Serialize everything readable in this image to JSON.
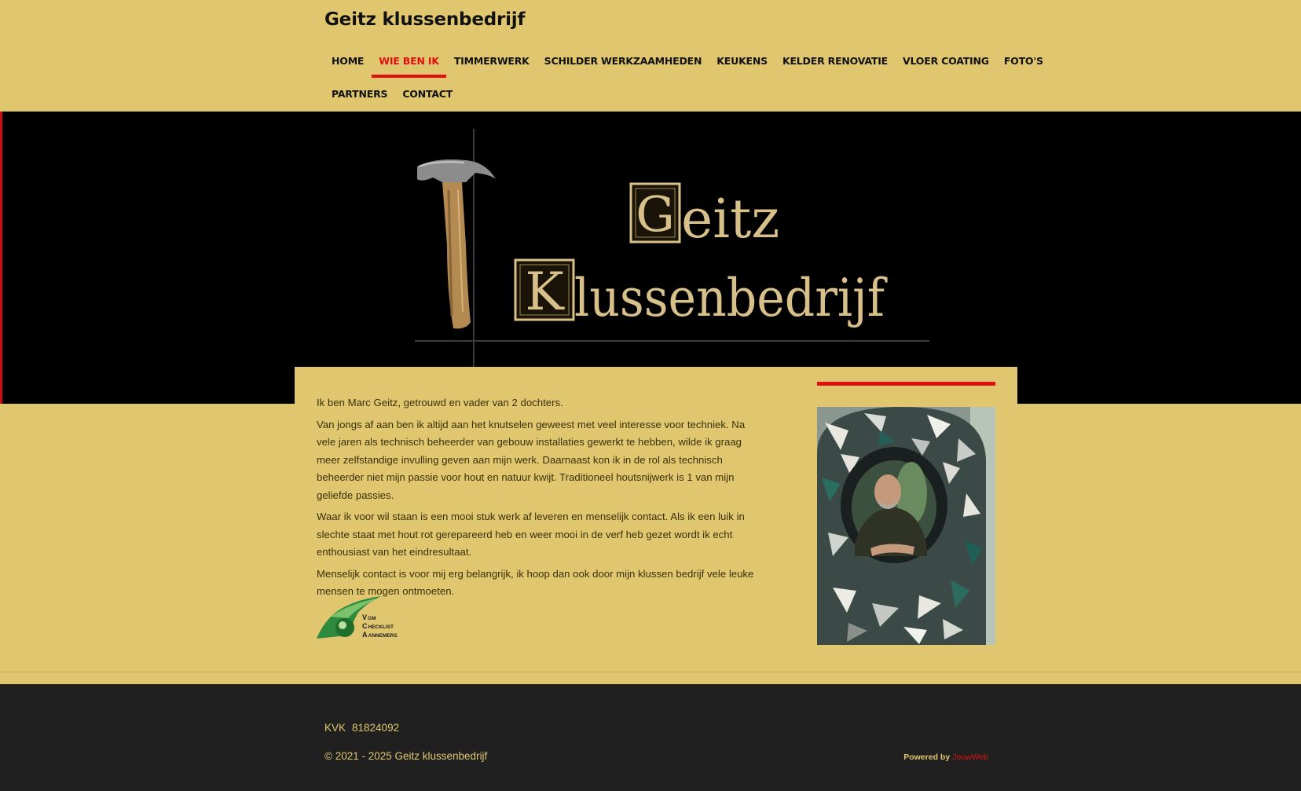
{
  "header": {
    "site_title": "Geitz klussenbedrijf",
    "nav_row1": [
      {
        "label": "HOME",
        "active": false
      },
      {
        "label": "WIE BEN IK",
        "active": true
      },
      {
        "label": "TIMMERWERK",
        "active": false
      },
      {
        "label": "SCHILDER WERKZAAMHEDEN",
        "active": false
      },
      {
        "label": "KEUKENS",
        "active": false
      },
      {
        "label": "KELDER RENOVATIE",
        "active": false
      },
      {
        "label": "VLOER COATING",
        "active": false
      },
      {
        "label": "FOTO'S",
        "active": false
      }
    ],
    "nav_row2": [
      {
        "label": "PARTNERS",
        "active": false
      },
      {
        "label": "CONTACT",
        "active": false
      }
    ]
  },
  "banner": {
    "logo_line1": "Geitz",
    "logo_line2": "Klussenbedrijf",
    "logo_initial1": "G",
    "logo_initial2": "K",
    "logo_rest1": "eitz",
    "logo_rest2": "lussenbedrijf"
  },
  "content": {
    "paragraphs": [
      "Ik ben Marc Geitz, getrouwd en vader van 2 dochters.",
      "Van jongs af aan ben ik altijd aan het knutselen geweest met veel interesse voor techniek. Na vele jaren als technisch beheerder van gebouw installaties gewerkt te hebben, wilde ik graag meer zelfstandige invulling geven aan mijn werk. Daarnaast kon ik in de rol als technisch beheerder niet mijn passie voor hout en natuur kwijt. Traditioneel houtsnijwerk is 1 van mijn geliefde passies.",
      "Waar ik voor wil staan is een mooi stuk werk af leveren en menselijk contact. Als ik een luik in slechte staat met hout rot gerepareerd heb en weer mooi in de verf heb gezet wordt ik echt enthousiast van het eindresultaat.",
      "Menselijk contact is voor mij erg belangrijk, ik hoop dan ook door mijn klussen bedrijf vele leuke mensen te mogen ontmoeten."
    ],
    "vca_logo": {
      "line1_cap": "V",
      "line1_rest": "GM",
      "line2_cap": "C",
      "line2_rest": "HECKLIST",
      "line3_cap": "A",
      "line3_rest": "ANNEMERS"
    }
  },
  "footer": {
    "kvk_label": "KVK",
    "kvk_number": "81824092",
    "copyright": "© 2021 - 2025 Geitz klussenbedrijf",
    "powered_by": "Powered by",
    "powered_link": "JouwWeb"
  },
  "colors": {
    "background": "#e0c76f",
    "accent": "#e01010",
    "footer_bg": "#202020",
    "banner_bg": "#000000"
  }
}
